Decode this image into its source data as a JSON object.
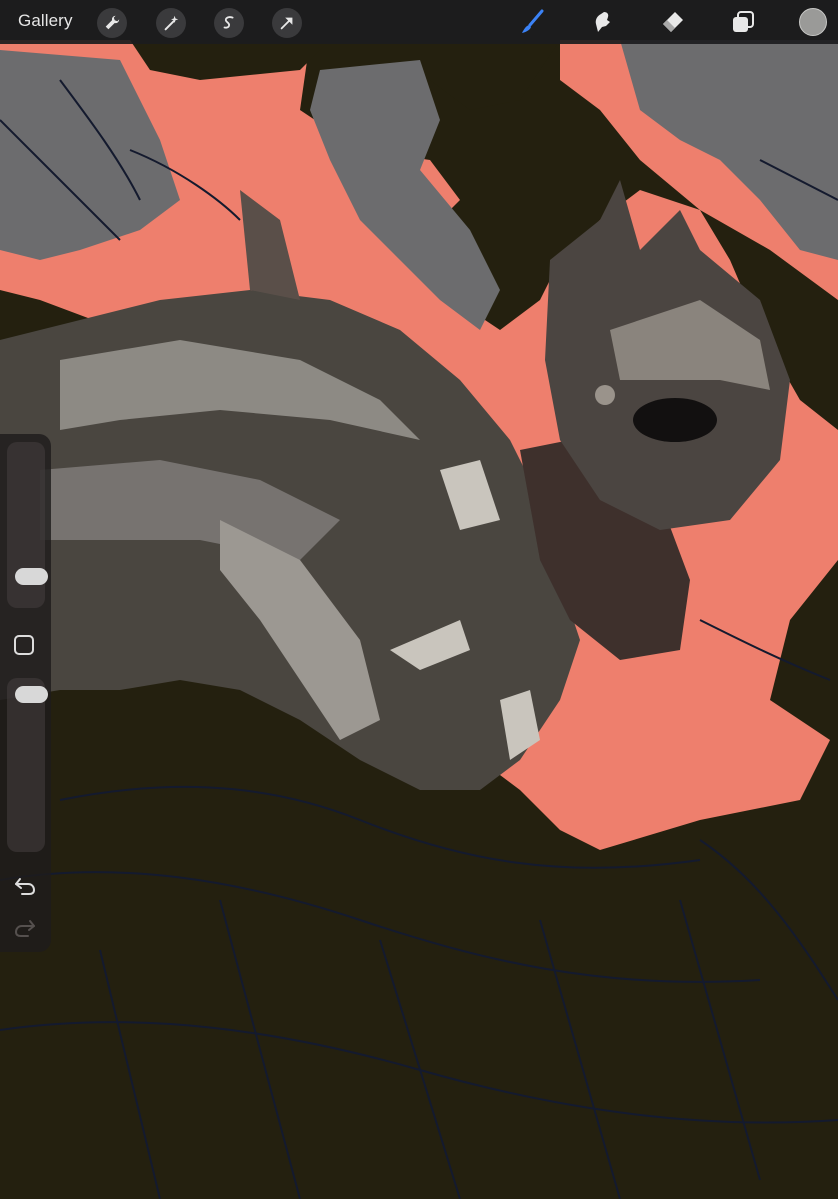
{
  "toolbar": {
    "gallery_label": "Gallery",
    "left_tools": [
      "wrench-icon",
      "magic-wand-icon",
      "selection-icon",
      "transform-arrow-icon"
    ],
    "right_tools": [
      "brush-icon",
      "smudge-icon",
      "eraser-icon",
      "layers-icon"
    ],
    "active_tool": "brush-icon",
    "active_color": "#9a9a98",
    "accent_color": "#3b82f6"
  },
  "sidebar": {
    "size_slider_icon": "brush-size-slider",
    "opacity_slider_icon": "opacity-slider",
    "modify_button_icon": "square-icon",
    "undo_icon": "undo-icon",
    "redo_icon": "redo-icon",
    "redo_enabled": false
  },
  "canvas": {
    "background_color": "#24200f",
    "highlight_color": "#ee7f6d",
    "grey_color": "#6c6c6e"
  }
}
